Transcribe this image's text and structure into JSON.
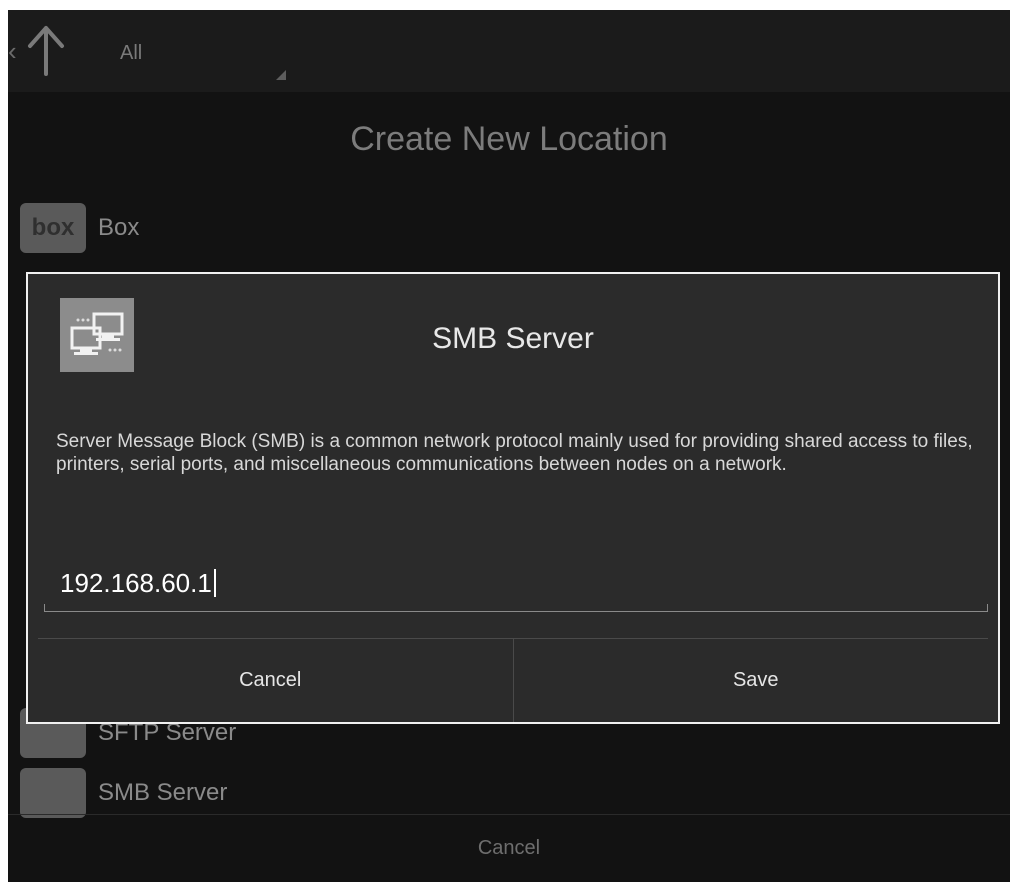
{
  "actionbar": {
    "filter_label": "All"
  },
  "chooser": {
    "title": "Create New Location",
    "items": [
      {
        "icon_text": "box",
        "label": "Box"
      },
      {
        "label": "SFTP Server"
      },
      {
        "label": "SMB Server"
      }
    ],
    "cancel_label": "Cancel"
  },
  "dialog": {
    "title": "SMB Server",
    "description": "Server Message Block (SMB) is a common network protocol mainly used for providing shared access to files, printers, serial ports, and miscellaneous communications between nodes on a network.",
    "ip_value": "192.168.60.1",
    "cancel_label": "Cancel",
    "save_label": "Save"
  },
  "colors": {
    "background": "#121212",
    "dialog_background": "#2b2b2b",
    "dialog_border": "#f0f0f0",
    "text_primary": "#e8e8e8"
  },
  "icons": [
    "up-arrow-icon",
    "network-computers-icon",
    "box-logo-icon"
  ]
}
